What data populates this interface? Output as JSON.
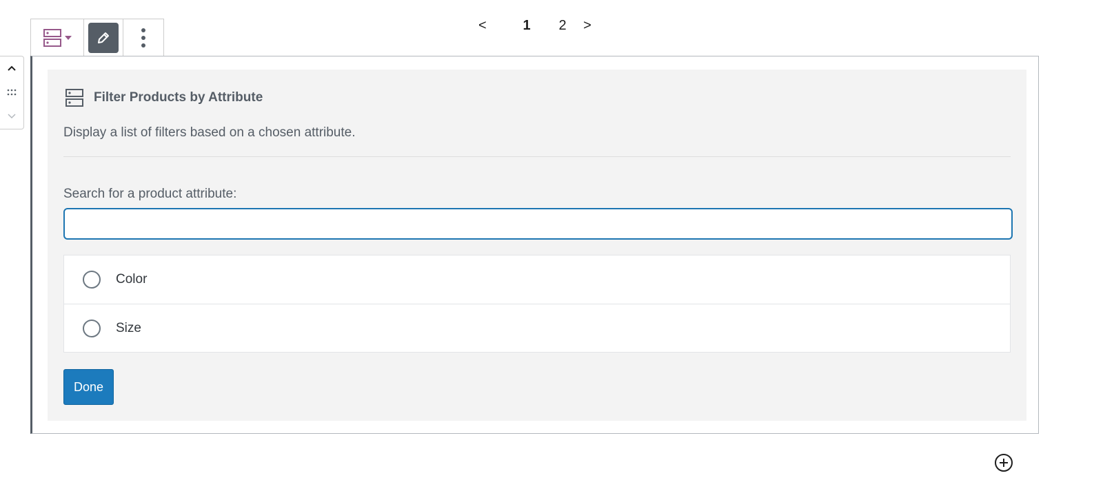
{
  "toolbar": {
    "switcher_icon": "filter-list-icon",
    "edit_icon": "pencil-icon",
    "more_icon": "more-vertical-icon",
    "brand_color": "#96588a"
  },
  "pagination": {
    "prev": "<",
    "pages": [
      "1",
      "2"
    ],
    "current": "1",
    "next": ">"
  },
  "mover": {
    "up_icon": "chevron-up-icon",
    "drag_icon": "drag-handle-icon",
    "down_icon": "chevron-down-icon"
  },
  "block": {
    "icon": "filter-list-icon",
    "title": "Filter Products by Attribute",
    "description": "Display a list of filters based on a chosen attribute.",
    "search": {
      "label": "Search for a product attribute:",
      "value": "",
      "placeholder": ""
    },
    "attributes": [
      {
        "label": "Color",
        "selected": false
      },
      {
        "label": "Size",
        "selected": false
      }
    ],
    "done_label": "Done",
    "accent_color": "#1c7bbd"
  },
  "inserter": {
    "icon": "plus-circle-icon"
  }
}
